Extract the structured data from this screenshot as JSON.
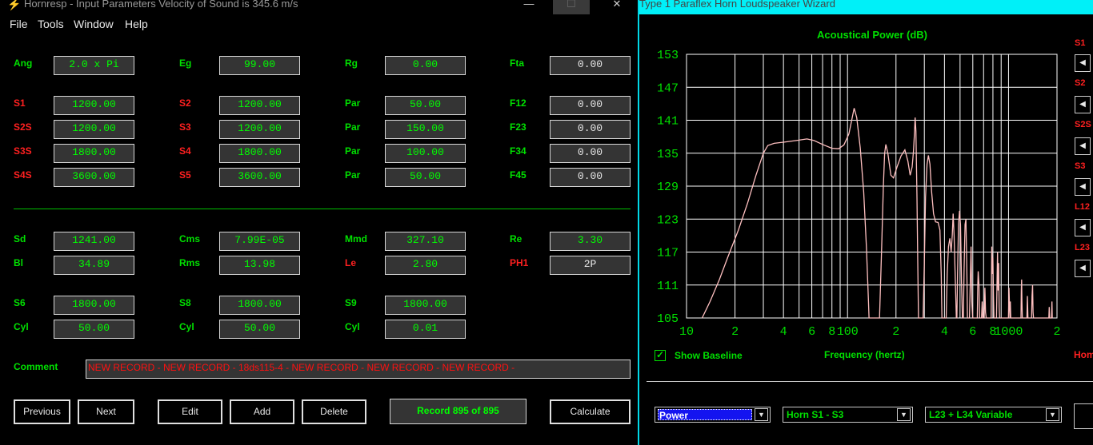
{
  "left_window": {
    "title": "Hornresp - Input Parameters   Velocity of Sound is 345.6 m/s",
    "controls": {
      "minimize": "—",
      "maximize": "☐",
      "close": "✕"
    },
    "menu": [
      "File",
      "Tools",
      "Window",
      "Help"
    ],
    "params": {
      "ang": {
        "label": "Ang",
        "value": "2.0 x Pi"
      },
      "eg": {
        "label": "Eg",
        "value": "99.00"
      },
      "rg": {
        "label": "Rg",
        "value": "0.00"
      },
      "fta": {
        "label": "Fta",
        "value": "0.00"
      },
      "s1": {
        "label": "S1",
        "value": "1200.00"
      },
      "s2": {
        "label": "S2",
        "value": "1200.00"
      },
      "par1": {
        "label": "Par",
        "value": "50.00"
      },
      "f12": {
        "label": "F12",
        "value": "0.00"
      },
      "s2s": {
        "label": "S2S",
        "value": "1200.00"
      },
      "s3": {
        "label": "S3",
        "value": "1200.00"
      },
      "par2": {
        "label": "Par",
        "value": "150.00"
      },
      "f23": {
        "label": "F23",
        "value": "0.00"
      },
      "s3s": {
        "label": "S3S",
        "value": "1800.00"
      },
      "s4": {
        "label": "S4",
        "value": "1800.00"
      },
      "par3": {
        "label": "Par",
        "value": "100.00"
      },
      "f34": {
        "label": "F34",
        "value": "0.00"
      },
      "s4s": {
        "label": "S4S",
        "value": "3600.00"
      },
      "s5": {
        "label": "S5",
        "value": "3600.00"
      },
      "par4": {
        "label": "Par",
        "value": "50.00"
      },
      "f45": {
        "label": "F45",
        "value": "0.00"
      },
      "sd": {
        "label": "Sd",
        "value": "1241.00"
      },
      "cms": {
        "label": "Cms",
        "value": "7.99E-05"
      },
      "mmd": {
        "label": "Mmd",
        "value": "327.10"
      },
      "re": {
        "label": "Re",
        "value": "3.30"
      },
      "bl": {
        "label": "Bl",
        "value": "34.89"
      },
      "rms": {
        "label": "Rms",
        "value": "13.98"
      },
      "le": {
        "label": "Le",
        "value": "2.80"
      },
      "ph1": {
        "label": "PH1",
        "value": "2P"
      },
      "s6": {
        "label": "S6",
        "value": "1800.00"
      },
      "s8": {
        "label": "S8",
        "value": "1800.00"
      },
      "s9": {
        "label": "S9",
        "value": "1800.00"
      },
      "cyl1": {
        "label": "Cyl",
        "value": "50.00"
      },
      "cyl2": {
        "label": "Cyl",
        "value": "50.00"
      },
      "cyl3": {
        "label": "Cyl",
        "value": "0.01"
      }
    },
    "comment": {
      "label": "Comment",
      "value": "NEW RECORD - NEW RECORD - 18ds115-4 - NEW RECORD - NEW RECORD - NEW RECORD -"
    },
    "buttons": {
      "previous": "Previous",
      "next": "Next",
      "edit": "Edit",
      "add": "Add",
      "delete": "Delete",
      "calculate": "Calculate"
    },
    "record": "Record 895 of 895"
  },
  "right_window": {
    "title": "Type 1 Paraflex Horn Loudspeaker Wizard",
    "side_labels": [
      "S1",
      "S2",
      "S2S",
      "S3",
      "L12",
      "L23"
    ],
    "side_button_icon": "◀",
    "show_baseline": {
      "label": "Show Baseline",
      "checked": true,
      "check_glyph": "✓"
    },
    "frequency_label": "Frequency (hertz)",
    "cut_label": "Hom",
    "dropdowns": {
      "mode": "Power",
      "segment": "Horn S1 - S3",
      "variable": "L23 + L34 Variable"
    },
    "dropdown_icon": "▼"
  },
  "chart_data": {
    "type": "line",
    "title": "Acoustical Power (dB)",
    "xlabel": "Frequency (hertz)",
    "x_scale": "log",
    "xlim": [
      10,
      2000
    ],
    "ylim": [
      105,
      153
    ],
    "y_ticks": [
      105,
      111,
      117,
      123,
      129,
      135,
      141,
      147,
      153
    ],
    "x_tick_labels": [
      {
        "value": 10,
        "label": "10"
      },
      {
        "value": 20,
        "label": "2"
      },
      {
        "value": 40,
        "label": "4"
      },
      {
        "value": 60,
        "label": "6"
      },
      {
        "value": 80,
        "label": "8"
      },
      {
        "value": 100,
        "label": "100"
      },
      {
        "value": 200,
        "label": "2"
      },
      {
        "value": 400,
        "label": "4"
      },
      {
        "value": 600,
        "label": "6"
      },
      {
        "value": 800,
        "label": "8"
      },
      {
        "value": 1000,
        "label": "1000"
      },
      {
        "value": 2000,
        "label": "2"
      }
    ],
    "grid": true,
    "colors": {
      "line": "#ffc0c0",
      "grid": "#ffffff",
      "plot_bg": "#000000",
      "text": "#00e000"
    },
    "series": [
      {
        "values": [
          [
            12.5,
            105
          ],
          [
            14,
            108
          ],
          [
            16,
            112
          ],
          [
            18,
            116
          ],
          [
            21,
            121
          ],
          [
            24,
            126
          ],
          [
            27,
            131
          ],
          [
            30,
            135
          ],
          [
            32,
            136.4
          ],
          [
            35,
            136.8
          ],
          [
            40,
            137
          ],
          [
            48,
            137.3
          ],
          [
            56,
            137.6
          ],
          [
            62,
            137.3
          ],
          [
            70,
            136.6
          ],
          [
            80,
            135.9
          ],
          [
            88,
            135.8
          ],
          [
            95,
            136.5
          ],
          [
            102,
            138.5
          ],
          [
            107,
            141.5
          ],
          [
            110,
            143.2
          ],
          [
            114,
            141.5
          ],
          [
            120,
            136
          ],
          [
            126,
            128
          ],
          [
            131,
            118
          ],
          [
            135,
            108
          ],
          [
            136,
            105
          ],
          [
            158,
            105
          ],
          [
            163,
            118
          ],
          [
            167,
            129
          ],
          [
            170,
            135
          ],
          [
            173,
            136.6
          ],
          [
            178,
            135
          ],
          [
            186,
            131
          ],
          [
            193,
            130.5
          ],
          [
            203,
            132.5
          ],
          [
            215,
            134.5
          ],
          [
            227,
            135.6
          ],
          [
            237,
            133.6
          ],
          [
            245,
            131
          ],
          [
            252,
            132.5
          ],
          [
            257,
            135.5
          ],
          [
            261,
            139
          ],
          [
            263,
            141.5
          ],
          [
            266,
            139
          ],
          [
            270,
            127
          ],
          [
            273,
            115
          ],
          [
            276,
            105
          ],
          [
            295,
            105
          ],
          [
            300,
            115
          ],
          [
            305,
            127
          ],
          [
            312,
            133
          ],
          [
            318,
            134.6
          ],
          [
            325,
            133
          ],
          [
            333,
            128
          ],
          [
            342,
            124
          ],
          [
            352,
            122.5
          ],
          [
            365,
            122.4
          ],
          [
            375,
            121
          ],
          [
            382,
            113
          ],
          [
            386,
            105
          ],
          [
            410,
            105
          ],
          [
            416,
            113
          ],
          [
            424,
            118
          ],
          [
            432,
            119.5
          ],
          [
            440,
            117
          ],
          [
            447,
            120
          ],
          [
            453,
            124
          ],
          [
            459,
            120
          ],
          [
            468,
            111
          ],
          [
            474,
            105
          ],
          [
            478,
            105
          ],
          [
            482,
            113
          ],
          [
            489,
            122
          ],
          [
            496,
            124.5
          ],
          [
            503,
            122
          ],
          [
            510,
            112
          ],
          [
            517,
            105
          ],
          [
            524,
            105
          ],
          [
            530,
            114
          ],
          [
            537,
            122
          ],
          [
            544,
            123
          ],
          [
            551,
            114
          ],
          [
            556,
            105
          ],
          [
            572,
            105
          ],
          [
            579,
            112
          ],
          [
            585,
            118
          ],
          [
            592,
            108
          ],
          [
            599,
            105
          ],
          [
            640,
            105
          ],
          [
            644,
            111
          ],
          [
            648,
            113.5
          ],
          [
            655,
            111
          ],
          [
            661,
            105
          ],
          [
            680,
            105
          ],
          [
            686,
            108
          ],
          [
            692,
            105
          ],
          [
            706,
            105
          ],
          [
            713,
            110.5
          ],
          [
            720,
            106
          ],
          [
            727,
            105
          ],
          [
            780,
            105
          ],
          [
            787,
            118
          ],
          [
            793,
            113
          ],
          [
            800,
            116
          ],
          [
            806,
            109
          ],
          [
            812,
            105
          ],
          [
            842,
            105
          ],
          [
            849,
            112
          ],
          [
            855,
            117
          ],
          [
            861,
            110
          ],
          [
            868,
            115
          ],
          [
            874,
            107
          ],
          [
            880,
            105
          ],
          [
            1000,
            105
          ],
          [
            1007,
            110.5
          ],
          [
            1013,
            107.5
          ],
          [
            1020,
            105
          ],
          [
            1026,
            108
          ],
          [
            1032,
            105
          ],
          [
            1195,
            105
          ],
          [
            1200,
            110
          ],
          [
            1206,
            112
          ],
          [
            1212,
            108
          ],
          [
            1218,
            105
          ],
          [
            1300,
            105
          ],
          [
            1310,
            109
          ],
          [
            1320,
            105
          ],
          [
            1390,
            105
          ],
          [
            1400,
            109
          ],
          [
            1410,
            111
          ],
          [
            1420,
            106
          ],
          [
            1430,
            105
          ],
          [
            1780,
            105
          ],
          [
            1790,
            107
          ],
          [
            1800,
            105
          ],
          [
            1850,
            105
          ],
          [
            1860,
            108
          ],
          [
            1870,
            105
          ]
        ]
      }
    ]
  }
}
